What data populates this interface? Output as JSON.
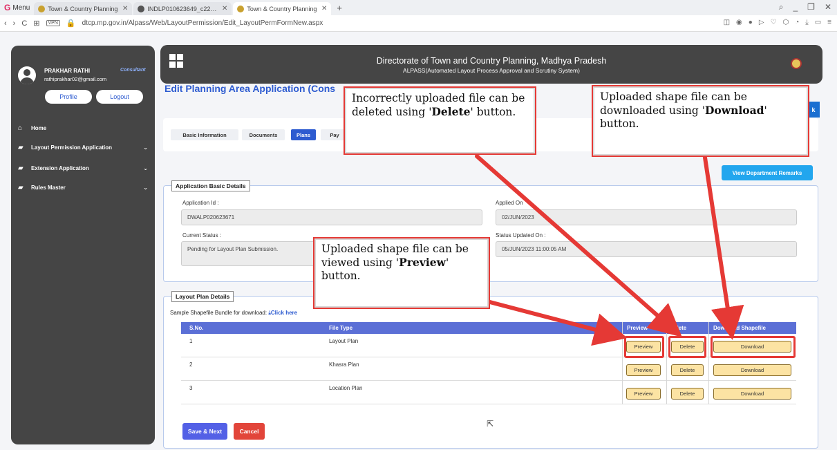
{
  "browser": {
    "menu_label": "Menu",
    "tabs": [
      {
        "label": "Town & Country Planning"
      },
      {
        "label": "INDLP010623649_c22cf95"
      },
      {
        "label": "Town & Country Planning"
      }
    ],
    "url": "dtcp.mp.gov.in/Alpass/Web/LayoutPermission/Edit_LayoutPermFormNew.aspx",
    "vpn": "VPN"
  },
  "sidebar": {
    "user_name": "PRAKHAR RATHI",
    "user_role": "Consultant",
    "user_email": "rathiprakhar02@gmail.com",
    "profile_label": "Profile",
    "logout_label": "Logout",
    "items": [
      {
        "label": "Home"
      },
      {
        "label": "Layout Permission Application"
      },
      {
        "label": "Extension Application"
      },
      {
        "label": "Rules Master"
      }
    ]
  },
  "header": {
    "title": "Directorate of Town and Country Planning, Madhya Pradesh",
    "subtitle": "ALPASS(Automated Layout Process Approval and Scrutiny System)"
  },
  "page": {
    "title": "Edit Planning Area Application (Cons",
    "back_label": "k",
    "tabs": [
      {
        "label": "Basic Information"
      },
      {
        "label": "Documents"
      },
      {
        "label": "Plans"
      },
      {
        "label": "Pay"
      }
    ],
    "remarks_label": "View Department Remarks"
  },
  "basic_details": {
    "legend": "Application Basic Details",
    "app_id_label": "Application Id :",
    "app_id_value": "DWALP020623671",
    "applied_on_label": "Applied On",
    "applied_on_value": "02/JUN/2023",
    "status_label": "Current Status :",
    "status_value": "Pending for Layout Plan Submission.",
    "status_updated_label": "Status Updated On :",
    "status_updated_value": "05/JUN/2023 11:00:05 AM"
  },
  "layout_plan": {
    "legend": "Layout Plan Details",
    "sample_text": "Sample Shapefile Bundle for download:",
    "sample_link": "Click here",
    "headers": {
      "sno": "S.No.",
      "file_type": "File Type",
      "preview": "Preview",
      "delete": "elete",
      "download": "Download Shapefile"
    },
    "rows": [
      {
        "sno": "1",
        "file_type": "Layout Plan",
        "preview": "Preview",
        "delete": "Delete",
        "download": "Download"
      },
      {
        "sno": "2",
        "file_type": "Khasra Plan",
        "preview": "Preview",
        "delete": "Delete",
        "download": "Download"
      },
      {
        "sno": "3",
        "file_type": "Location Plan",
        "preview": "Preview",
        "delete": "Delete",
        "download": "Download"
      }
    ],
    "save_label": "Save & Next",
    "cancel_label": "Cancel"
  },
  "callouts": {
    "delete": {
      "pre": "Incorrectly uploaded file can be deleted using '",
      "bold": "Delete",
      "post": "' button."
    },
    "download": {
      "pre": "Uploaded shape file can be downloaded using '",
      "bold": "Download",
      "post": "' button."
    },
    "preview": {
      "pre": "Uploaded shape file can be viewed using '",
      "bold": "Preview",
      "post": "' button."
    }
  },
  "colors": {
    "accent": "#2d5bd0",
    "annotation": "#e53935",
    "sidebar_bg": "#454545"
  }
}
